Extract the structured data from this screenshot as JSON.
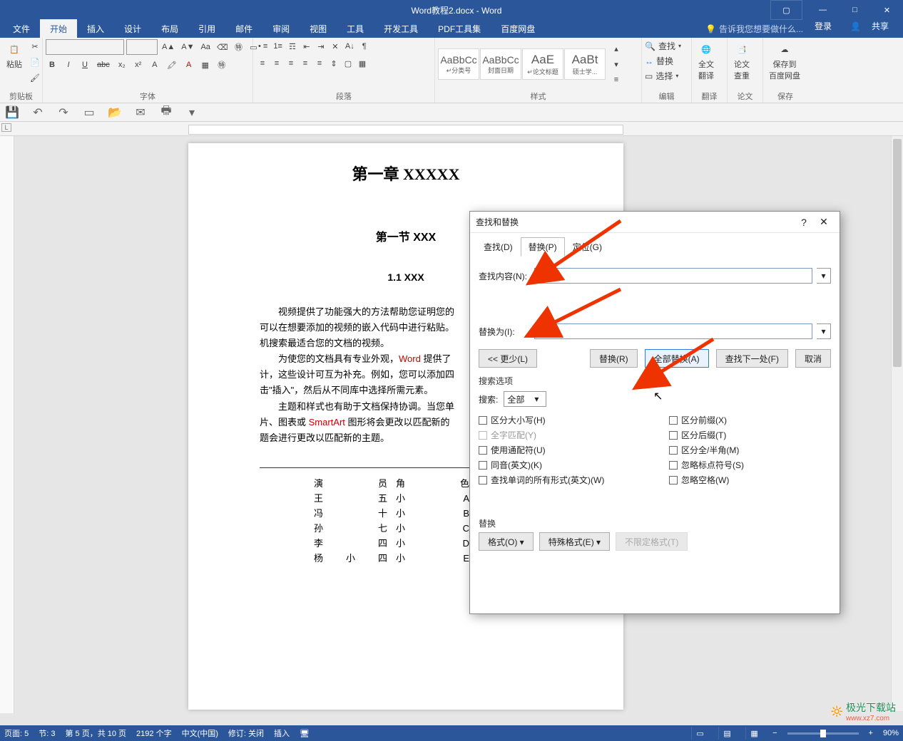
{
  "titlebar": {
    "title": "Word教程2.docx - Word",
    "min": "—",
    "max": "□",
    "close": "✕",
    "ribopt": "▢"
  },
  "tabs": {
    "file": "文件",
    "home": "开始",
    "insert": "插入",
    "design": "设计",
    "layout": "布局",
    "references": "引用",
    "mail": "邮件",
    "review": "审阅",
    "view": "视图",
    "tools": "工具",
    "dev": "开发工具",
    "pdf": "PDF工具集",
    "baidu": "百度网盘",
    "tellme_icon": "💡",
    "tellme": "告诉我您想要做什么...",
    "login": "登录",
    "share_icon": "👤",
    "share": "共享"
  },
  "ribbon": {
    "clipboard": {
      "paste": "粘贴",
      "label": "剪贴板"
    },
    "font": {
      "label": "字体",
      "row1": [
        "B",
        "I",
        "U",
        "abc",
        "x₂",
        "x²",
        "A"
      ],
      "size_up": "A▲",
      "size_dn": "A▼",
      "aa": "Aa",
      "clear": "⌫",
      "pinyin": "㊕",
      "border": "▭"
    },
    "paragraph": {
      "label": "段落"
    },
    "styles": {
      "label": "样式",
      "items": [
        {
          "preview": "AaBbCc",
          "name": "↵分类号"
        },
        {
          "preview": "AaBbCc",
          "name": "封面日期"
        },
        {
          "preview": "AaE",
          "name": "↵论文标题"
        },
        {
          "preview": "AaBt",
          "name": "硕士学..."
        }
      ]
    },
    "editing": {
      "find": "查找",
      "replace": "替换",
      "select": "选择",
      "label": "编辑",
      "find_icon": "🔍",
      "replace_icon": "↔",
      "select_icon": "▭"
    },
    "translate": {
      "btn": "全文\n翻译",
      "label": "翻译"
    },
    "chachong": {
      "btn": "论文\n查重",
      "label": "论文"
    },
    "save": {
      "btn": "保存到\n百度网盘",
      "label": "保存"
    }
  },
  "qat": {
    "save": "💾",
    "undo": "↶",
    "redo": "↷",
    "new": "▭",
    "open": "📂",
    "mail": "✉",
    "print": "🖶",
    "more": "▾"
  },
  "ruler": {
    "corner": "L"
  },
  "doc": {
    "h1": "第一章  XXXXX",
    "h2": "第一节  XXX",
    "h3": "1.1 XXX",
    "p1a": "视频提供了功能强大的方法帮助您证明您的",
    "p1b": "可以在想要添加的视频的嵌入代码中进行粘贴。",
    "p1c": "机搜索最适合您的文档的视频。",
    "p2a": "为使您的文档具有专业外观，",
    "p2red": "Word",
    "p2b": " 提供了",
    "p2c": "计，这些设计可互为补充。例如，您可以添加四",
    "p2d": "击\"插入\"，然后从不同库中选择所需元素。",
    "p3a": "主题和样式也有助于文档保持协调。当您单",
    "p3b": "片、图表或 ",
    "p3red": "SmartArt",
    "p3c": " 图形将会更改以匹配新的",
    "p3d": "题会进行更改以匹配新的主题。",
    "table": {
      "headers": [
        "演　员",
        "角　色"
      ],
      "rows": [
        [
          "王　　五",
          "小　　A"
        ],
        [
          "冯　　十",
          "小　　B"
        ],
        [
          "孙　　七",
          "小　　C"
        ],
        [
          "李　　四",
          "小　　D"
        ],
        [
          "杨 小 四",
          "小　　E"
        ]
      ]
    }
  },
  "dialog": {
    "title": "查找和替换",
    "help": "?",
    "close": "✕",
    "tabs": {
      "find": "查找(D)",
      "replace": "替换(P)",
      "goto": "定位(G)"
    },
    "find_label": "查找内容(N):",
    "find_value": "小",
    "replace_label": "替换为(I):",
    "replace_value": "",
    "less": "<< 更少(L)",
    "replace_btn": "替换(R)",
    "replace_all": "全部替换(A)",
    "find_next": "查找下一处(F)",
    "cancel": "取消",
    "options_label": "搜索选项",
    "search_label": "搜索:",
    "search_value": "全部",
    "dd": "▾",
    "checks_left": [
      "区分大小写(H)",
      "全字匹配(Y)",
      "使用通配符(U)",
      "同音(英文)(K)",
      "查找单词的所有形式(英文)(W)"
    ],
    "checks_right": [
      "区分前缀(X)",
      "区分后缀(T)",
      "区分全/半角(M)",
      "忽略标点符号(S)",
      "忽略空格(W)"
    ],
    "replace_section": "替换",
    "format_btn": "格式(O) ▾",
    "special_btn": "特殊格式(E) ▾",
    "noformat_btn": "不限定格式(T)"
  },
  "status": {
    "page": "页面: 5",
    "sec": "节: 3",
    "pages": "第 5 页，共 10 页",
    "words": "2192 个字",
    "lang": "中文(中国)",
    "track": "修订: 关闭",
    "insert": "插入",
    "zoom": "90%"
  },
  "watermark": {
    "brand": "极光下载站",
    "url": "www.xz7.com"
  }
}
